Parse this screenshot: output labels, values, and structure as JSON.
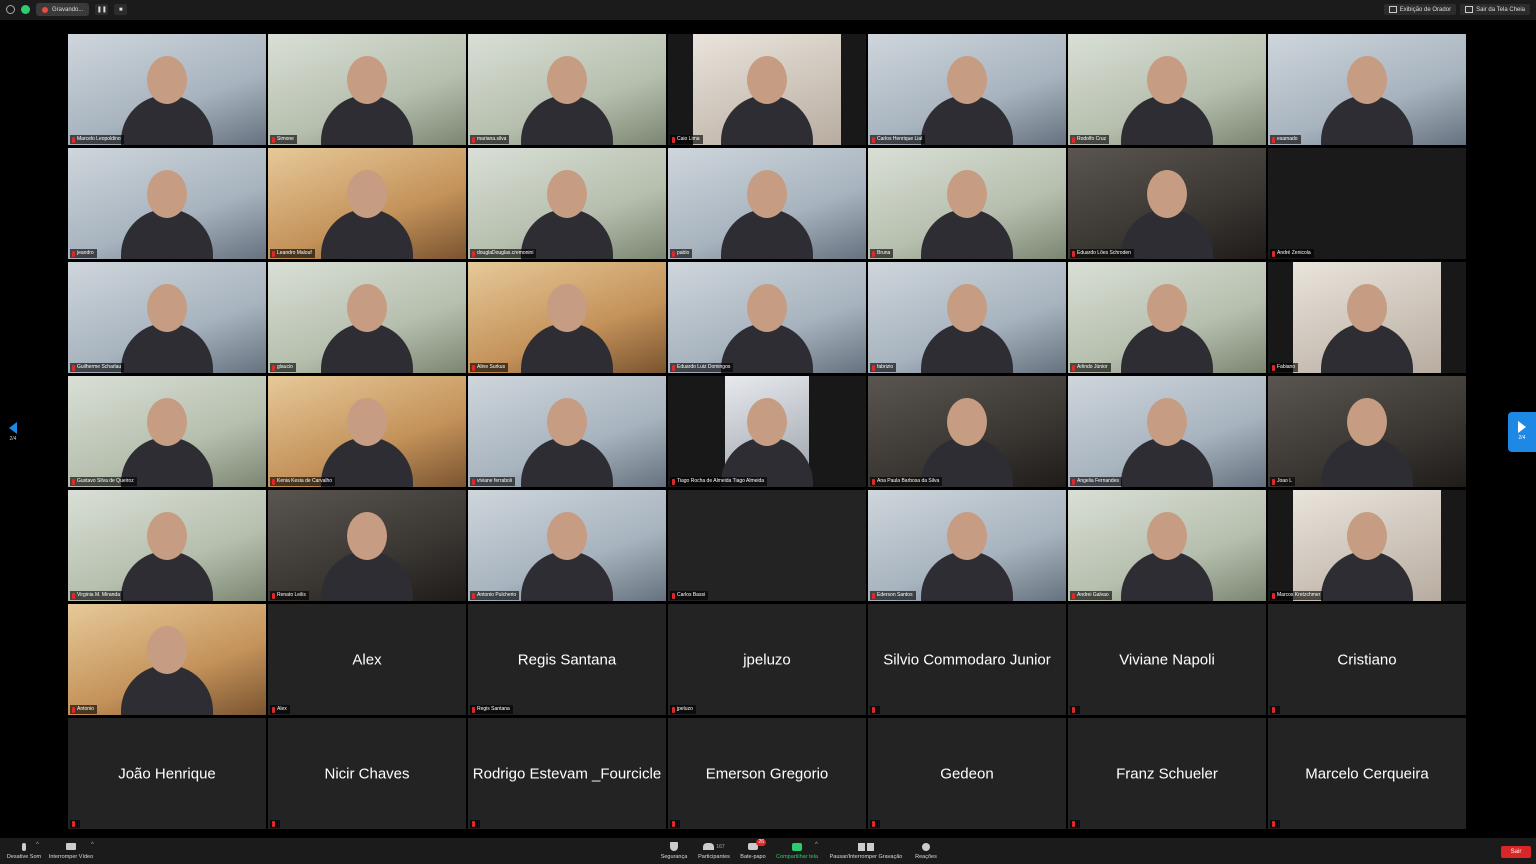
{
  "topbar": {
    "recording_label": "Gravando...",
    "speaker_view_label": "Exibição de Orador",
    "exit_fullscreen_label": "Sair da Tela Cheia"
  },
  "pagination": {
    "left_page": "2/4",
    "right_page": "2/4"
  },
  "tiles": [
    {
      "name": "Marcelo Leopoldino",
      "video": true,
      "tone": "cool"
    },
    {
      "name": "Simone",
      "video": true,
      "tone": "green"
    },
    {
      "name": "mariana.silva",
      "video": true,
      "tone": "green"
    },
    {
      "name": "Caio Lima",
      "video": true,
      "tone": "narrow"
    },
    {
      "name": "Carlos Henrique Lial",
      "video": true,
      "tone": "cool"
    },
    {
      "name": "Rodolfo Cruz",
      "video": true,
      "tone": "green"
    },
    {
      "name": "esamado",
      "video": true,
      "tone": "cool"
    },
    {
      "name": "jeandro",
      "video": true,
      "tone": "cool"
    },
    {
      "name": "Leandro Malouf",
      "video": true,
      "tone": "warm"
    },
    {
      "name": "douglaDouglas.cremonini",
      "video": true,
      "tone": "green"
    },
    {
      "name": "pablo",
      "video": true,
      "tone": "cool"
    },
    {
      "name": "Bruna",
      "video": true,
      "tone": "green"
    },
    {
      "name": "Eduardo Lões Schroden",
      "video": true,
      "tone": "dark"
    },
    {
      "name": "André Zenicola",
      "video": false,
      "blank": true,
      "big": ""
    },
    {
      "name": "Guilherme Scharlau",
      "video": true,
      "tone": "cool"
    },
    {
      "name": "glaucio",
      "video": true,
      "tone": "green"
    },
    {
      "name": "Aline Surkus",
      "video": true,
      "tone": "warm"
    },
    {
      "name": "Eduardo Luiz Domingos",
      "video": true,
      "tone": "cool"
    },
    {
      "name": "fabrizio",
      "video": true,
      "tone": "cool"
    },
    {
      "name": "Arlindo Júnior",
      "video": true,
      "tone": "green"
    },
    {
      "name": "Fabiano",
      "video": true,
      "tone": "narrow"
    },
    {
      "name": "Gustavo Silva de Queiroz",
      "video": true,
      "tone": "green"
    },
    {
      "name": "Kenia Kesia de Carvalho",
      "video": true,
      "tone": "warm"
    },
    {
      "name": "viviane ferraboli",
      "video": true,
      "tone": "cool"
    },
    {
      "name": "Tiago Rocha de Almeida Tiago Almeida",
      "video": true,
      "tone": "narrow-mid"
    },
    {
      "name": "Ana Paula Barbosa da Silva",
      "video": true,
      "tone": "dark"
    },
    {
      "name": "Angelia Fernandes",
      "video": true,
      "tone": "cool"
    },
    {
      "name": "Joao L",
      "video": true,
      "tone": "dark"
    },
    {
      "name": "Virginia M. Miranda",
      "video": true,
      "tone": "green"
    },
    {
      "name": "Renato Leilis",
      "video": true,
      "tone": "dark"
    },
    {
      "name": "Antonio Pulcherio",
      "video": true,
      "tone": "cool"
    },
    {
      "name": "Carlos Bassi",
      "video": false,
      "big": ""
    },
    {
      "name": "Ederson Santos",
      "video": true,
      "tone": "cool"
    },
    {
      "name": "Andrei Galvao",
      "video": true,
      "tone": "green"
    },
    {
      "name": "Marcos Kretzchmer",
      "video": true,
      "tone": "narrow"
    },
    {
      "name": "Antonio",
      "video": true,
      "tone": "warm"
    },
    {
      "name": "Alex",
      "video": false,
      "big": "Alex"
    },
    {
      "name": "Regis Santana",
      "video": false,
      "big": "Regis Santana"
    },
    {
      "name": "jpeluzo",
      "video": false,
      "big": "jpeluzo"
    },
    {
      "name": "",
      "video": false,
      "big": "Silvio Commodaro Junior"
    },
    {
      "name": "",
      "video": false,
      "big": "Viviane Napoli"
    },
    {
      "name": "",
      "video": false,
      "big": "Cristiano"
    },
    {
      "name": "",
      "video": false,
      "big": "João Henrique"
    },
    {
      "name": "",
      "video": false,
      "big": "Nicir Chaves"
    },
    {
      "name": "",
      "video": false,
      "big": "Rodrigo Estevam _Fourcicle"
    },
    {
      "name": "",
      "video": false,
      "big": "Emerson Gregorio"
    },
    {
      "name": "",
      "video": false,
      "big": "Gedeon"
    },
    {
      "name": "",
      "video": false,
      "big": "Franz Schueler"
    },
    {
      "name": "",
      "video": false,
      "big": "Marcelo Cerqueira"
    }
  ],
  "toolbar": {
    "mute_label": "Desative Som",
    "video_label": "Interromper Vídeo",
    "security_label": "Segurança",
    "participants_label": "Participantes",
    "participants_count": "167",
    "chat_label": "Bate-papo",
    "chat_badge": "26",
    "share_label": "Compartilhar tela",
    "record_label": "Pausar/Interromper Gravação",
    "reactions_label": "Reações",
    "leave_label": "Sair"
  },
  "colors": {
    "accent": "#1e88e5",
    "share_green": "#2ecc71",
    "leave_red": "#d92626",
    "muted_red": "#e02828"
  }
}
